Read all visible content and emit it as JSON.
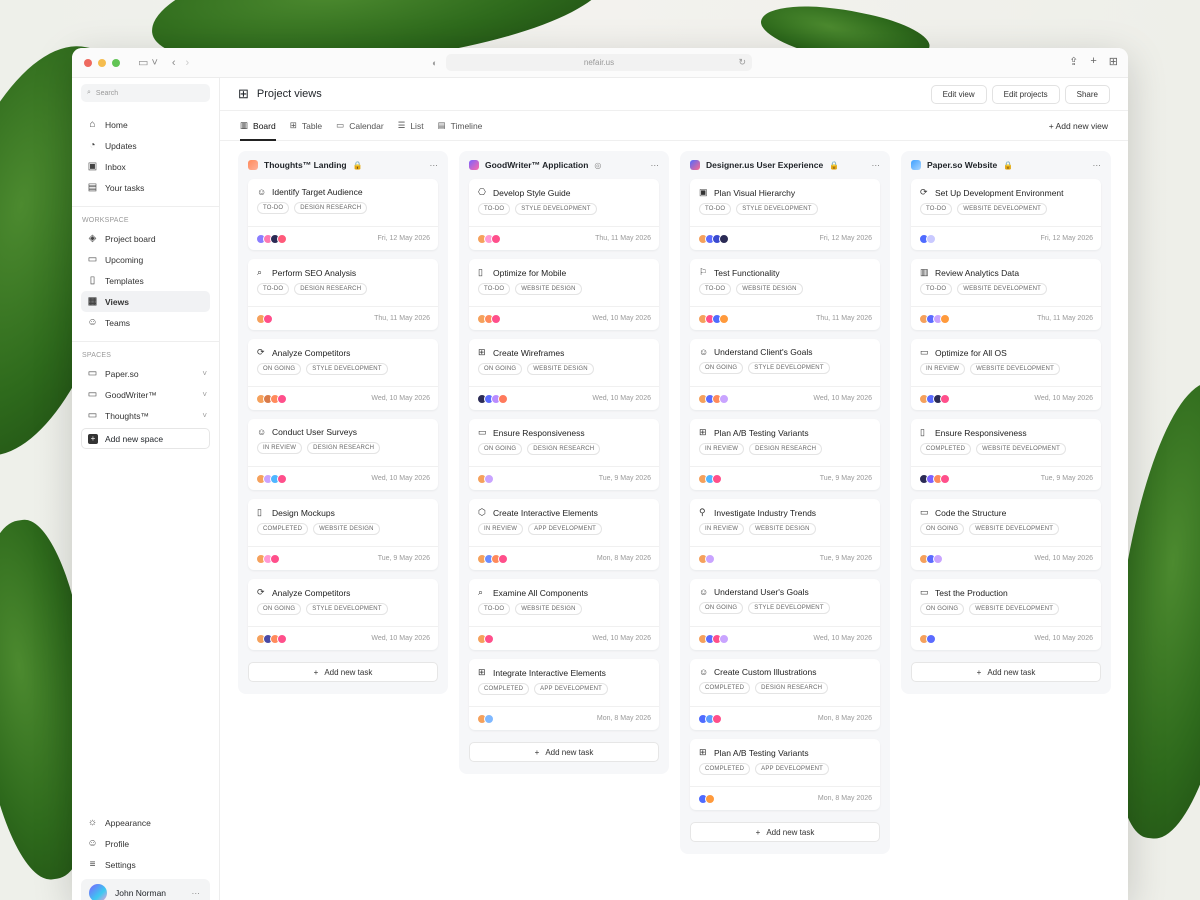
{
  "browser": {
    "url": "nefair.us"
  },
  "sidebar": {
    "search_placeholder": "Search",
    "top": [
      {
        "label": "Home",
        "icon": "⌂"
      },
      {
        "label": "Updates",
        "icon": "◔"
      },
      {
        "label": "Inbox",
        "icon": "▣"
      },
      {
        "label": "Your tasks",
        "icon": "▤"
      }
    ],
    "workspace_title": "WORKSPACE",
    "workspace": [
      {
        "label": "Project board",
        "icon": "◈"
      },
      {
        "label": "Upcoming",
        "icon": "▭"
      },
      {
        "label": "Templates",
        "icon": "▯"
      },
      {
        "label": "Views",
        "icon": "▦",
        "active": true
      },
      {
        "label": "Teams",
        "icon": "☺"
      }
    ],
    "spaces_title": "SPACES",
    "spaces": [
      {
        "label": "Paper.so"
      },
      {
        "label": "GoodWriter™"
      },
      {
        "label": "Thoughts™"
      }
    ],
    "add_space": "Add new space",
    "bottom": [
      {
        "label": "Appearance",
        "icon": "☼"
      },
      {
        "label": "Profile",
        "icon": "☺"
      },
      {
        "label": "Settings",
        "icon": "≡"
      }
    ],
    "user": {
      "name": "John Norman"
    }
  },
  "header": {
    "title": "Project views",
    "buttons": [
      "Edit view",
      "Edit projects",
      "Share"
    ]
  },
  "tabs": [
    {
      "label": "Board",
      "icon": "▥",
      "active": true
    },
    {
      "label": "Table",
      "icon": "⊞"
    },
    {
      "label": "Calendar",
      "icon": "▭"
    },
    {
      "label": "List",
      "icon": "☰"
    },
    {
      "label": "Timeline",
      "icon": "▤"
    }
  ],
  "add_view": "+ Add new view",
  "add_task": "Add new task",
  "columns": [
    {
      "title": "Thoughts™ Landing",
      "icon_color": "linear-gradient(135deg,#ff8a5c,#ffb199)",
      "lock": "🔒",
      "cards": [
        {
          "title": "Identify Target Audience",
          "icon": "☺",
          "status": "TO-DO",
          "tag": "DESIGN RESEARCH",
          "date": "Fri, 12 May 2026",
          "avatars": [
            "#8a7dff",
            "#ff7ab0",
            "#2b2b55",
            "#ff5a7a"
          ]
        },
        {
          "title": "Perform SEO Analysis",
          "icon": "⌕",
          "status": "TO-DO",
          "tag": "DESIGN RESEARCH",
          "date": "Thu, 11 May 2026",
          "avatars": [
            "#f5a15c",
            "#ff4f8b"
          ]
        },
        {
          "title": "Analyze Competitors",
          "icon": "⟳",
          "status": "ON GOING",
          "tag": "STYLE DEVELOPMENT",
          "date": "Wed, 10 May 2026",
          "avatars": [
            "#f5a15c",
            "#d97b4a",
            "#ff8a5c",
            "#ff4f8b"
          ]
        },
        {
          "title": "Conduct User Surveys",
          "icon": "☺",
          "status": "IN REVIEW",
          "tag": "DESIGN RESEARCH",
          "date": "Wed, 10 May 2026",
          "avatars": [
            "#f5a15c",
            "#c9a4ff",
            "#4fb6ff",
            "#ff4f8b"
          ]
        },
        {
          "title": "Design Mockups",
          "icon": "▯",
          "status": "COMPLETED",
          "tag": "WEBSITE DESIGN",
          "date": "Tue, 9 May 2026",
          "avatars": [
            "#f5a15c",
            "#ff9ad5",
            "#ff4f8b"
          ]
        },
        {
          "title": "Analyze Competitors",
          "icon": "⟳",
          "status": "ON GOING",
          "tag": "STYLE DEVELOPMENT",
          "date": "Wed, 10 May 2026",
          "avatars": [
            "#f5a15c",
            "#4a4aa5",
            "#ff8a5c",
            "#ff4f8b"
          ]
        }
      ]
    },
    {
      "title": "GoodWriter™ Application",
      "icon_color": "linear-gradient(135deg,#7b61ff,#ff6aa8)",
      "lock": "◎",
      "cards": [
        {
          "title": "Develop Style Guide",
          "icon": "⎔",
          "status": "TO-DO",
          "tag": "STYLE DEVELOPMENT",
          "date": "Thu, 11 May 2026",
          "avatars": [
            "#f5a15c",
            "#ff9ad5",
            "#ff4f8b"
          ]
        },
        {
          "title": "Optimize for Mobile",
          "icon": "▯",
          "status": "TO-DO",
          "tag": "WEBSITE DESIGN",
          "date": "Wed, 10 May 2026",
          "avatars": [
            "#f5a15c",
            "#ff8a5c",
            "#ff4f8b"
          ]
        },
        {
          "title": "Create Wireframes",
          "icon": "⊞",
          "status": "ON GOING",
          "tag": "WEBSITE DESIGN",
          "date": "Wed, 10 May 2026",
          "avatars": [
            "#2b2b55",
            "#5b6bff",
            "#b98cff",
            "#ff7a5c"
          ]
        },
        {
          "title": "Ensure Responsiveness",
          "icon": "▭",
          "status": "ON GOING",
          "tag": "DESIGN RESEARCH",
          "date": "Tue, 9 May 2026",
          "avatars": [
            "#f5a15c",
            "#c9a4ff"
          ]
        },
        {
          "title": "Create Interactive Elements",
          "icon": "⬡",
          "status": "IN REVIEW",
          "tag": "APP DEVELOPMENT",
          "date": "Mon, 8 May 2026",
          "avatars": [
            "#f5a15c",
            "#6b8cff",
            "#ff8a5c",
            "#ff4f8b"
          ]
        },
        {
          "title": "Examine All Components",
          "icon": "⌕",
          "status": "TO-DO",
          "tag": "WEBSITE DESIGN",
          "date": "Wed, 10 May 2026",
          "avatars": [
            "#f5a15c",
            "#ff4f8b"
          ]
        },
        {
          "title": "Integrate Interactive Elements",
          "icon": "⊞",
          "status": "COMPLETED",
          "tag": "APP DEVELOPMENT",
          "date": "Mon, 8 May 2026",
          "avatars": [
            "#f5a15c",
            "#7fb8ff"
          ]
        }
      ]
    },
    {
      "title": "Designer.us User Experience",
      "icon_color": "linear-gradient(135deg,#4f6bff,#ff6a8a)",
      "lock": "🔒",
      "cards": [
        {
          "title": "Plan Visual Hierarchy",
          "icon": "▣",
          "status": "TO-DO",
          "tag": "STYLE DEVELOPMENT",
          "date": "Fri, 12 May 2026",
          "avatars": [
            "#f5a15c",
            "#5b6bff",
            "#3a4ad0",
            "#2b2b55"
          ]
        },
        {
          "title": "Test Functionality",
          "icon": "⚐",
          "status": "TO-DO",
          "tag": "WEBSITE DESIGN",
          "date": "Thu, 11 May 2026",
          "avatars": [
            "#f5a15c",
            "#ff4f8b",
            "#4f6bff",
            "#ff9a3c"
          ]
        },
        {
          "title": "Understand Client's Goals",
          "icon": "☺",
          "status": "ON GOING",
          "tag": "STYLE DEVELOPMENT",
          "date": "Wed, 10 May 2026",
          "avatars": [
            "#f5a15c",
            "#5b6bff",
            "#ff8a5c",
            "#c9a4ff"
          ]
        },
        {
          "title": "Plan A/B Testing Variants",
          "icon": "⊞",
          "status": "IN REVIEW",
          "tag": "DESIGN RESEARCH",
          "date": "Tue, 9 May 2026",
          "avatars": [
            "#f5a15c",
            "#4fb6ff",
            "#ff4f8b"
          ]
        },
        {
          "title": "Investigate Industry Trends",
          "icon": "⚲",
          "status": "IN REVIEW",
          "tag": "WEBSITE DESIGN",
          "date": "Tue, 9 May 2026",
          "avatars": [
            "#f5a15c",
            "#c9a4ff"
          ]
        },
        {
          "title": "Understand User's Goals",
          "icon": "☺",
          "status": "ON GOING",
          "tag": "STYLE DEVELOPMENT",
          "date": "Wed, 10 May 2026",
          "avatars": [
            "#f5a15c",
            "#5b6bff",
            "#ff4f8b",
            "#c9a4ff"
          ]
        },
        {
          "title": "Create Custom Illustrations",
          "icon": "☺",
          "status": "COMPLETED",
          "tag": "DESIGN RESEARCH",
          "date": "Mon, 8 May 2026",
          "avatars": [
            "#4f6bff",
            "#5b9bff",
            "#ff4f8b"
          ]
        },
        {
          "title": "Plan A/B Testing Variants",
          "icon": "⊞",
          "status": "COMPLETED",
          "tag": "APP DEVELOPMENT",
          "date": "Mon, 8 May 2026",
          "avatars": [
            "#4f6bff",
            "#ff9a3c"
          ]
        }
      ]
    },
    {
      "title": "Paper.so Website",
      "icon_color": "linear-gradient(135deg,#3fa0ff,#a9d5ff)",
      "lock": "🔒",
      "cards": [
        {
          "title": "Set Up Development Environment",
          "icon": "⟳",
          "status": "TO-DO",
          "tag": "WEBSITE DEVELOPMENT",
          "date": "Fri, 12 May 2026",
          "avatars": [
            "#4f6bff",
            "#c9c9ff"
          ]
        },
        {
          "title": "Review Analytics Data",
          "icon": "▥",
          "status": "TO-DO",
          "tag": "WEBSITE DEVELOPMENT",
          "date": "Thu, 11 May 2026",
          "avatars": [
            "#f5a15c",
            "#5b6bff",
            "#c9a4ff",
            "#ff9a3c"
          ]
        },
        {
          "title": "Optimize for All OS",
          "icon": "▭",
          "status": "IN REVIEW",
          "tag": "WEBSITE DEVELOPMENT",
          "date": "Wed, 10 May 2026",
          "avatars": [
            "#f5a15c",
            "#5b6bff",
            "#2b2b55",
            "#ff4f8b"
          ]
        },
        {
          "title": "Ensure Responsiveness",
          "icon": "▯",
          "status": "COMPLETED",
          "tag": "WEBSITE DEVELOPMENT",
          "date": "Tue, 9 May 2026",
          "avatars": [
            "#2b2b55",
            "#7b61ff",
            "#ff8a5c",
            "#ff4f8b"
          ]
        },
        {
          "title": "Code the Structure",
          "icon": "▭",
          "status": "ON GOING",
          "tag": "WEBSITE DEVELOPMENT",
          "date": "Wed, 10 May 2026",
          "avatars": [
            "#f5a15c",
            "#5b6bff",
            "#c9a4ff"
          ]
        },
        {
          "title": "Test the Production",
          "icon": "▭",
          "status": "ON GOING",
          "tag": "WEBSITE DEVELOPMENT",
          "date": "Wed, 10 May 2026",
          "avatars": [
            "#f5a15c",
            "#5b6bff"
          ]
        }
      ]
    }
  ]
}
